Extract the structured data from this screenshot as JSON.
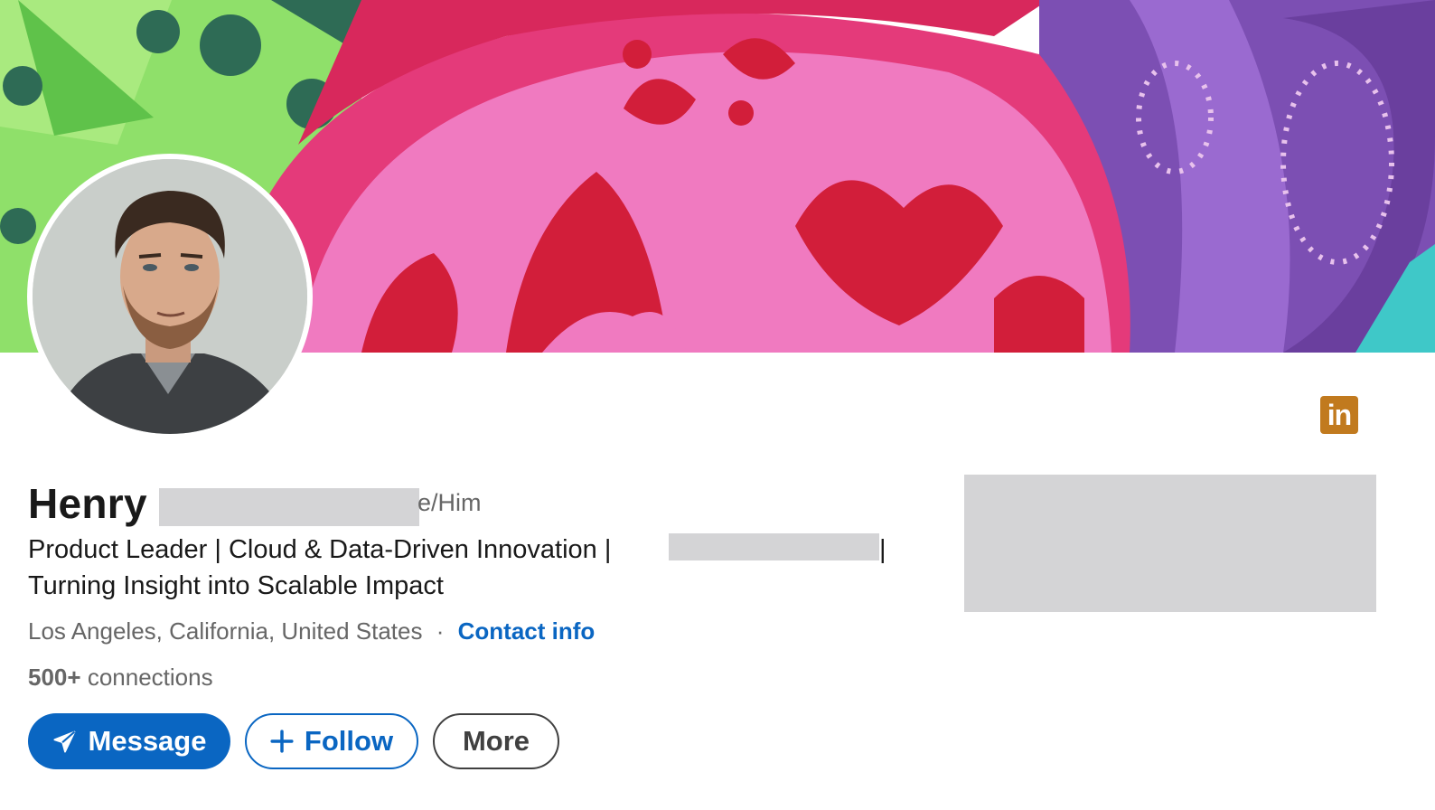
{
  "profile": {
    "first_name": "Henry",
    "pronouns": "e/Him",
    "headline_line1": "Product Leader | Cloud & Data-Driven Innovation |",
    "headline_pipe": "|",
    "headline_line2": "Turning Insight into Scalable Impact",
    "location": "Los Angeles, California, United States",
    "location_separator": "·",
    "contact_info": "Contact info",
    "connections_count": "500+",
    "connections_label": "connections"
  },
  "badge": {
    "text": "in"
  },
  "actions": {
    "message": "Message",
    "follow": "Follow",
    "more": "More"
  },
  "colors": {
    "brand_blue": "#0a66c2",
    "badge_orange": "#c17a1e",
    "redaction_gray": "#d4d4d6"
  },
  "icons": {
    "message": "paper-plane-icon",
    "follow": "plus-icon"
  }
}
